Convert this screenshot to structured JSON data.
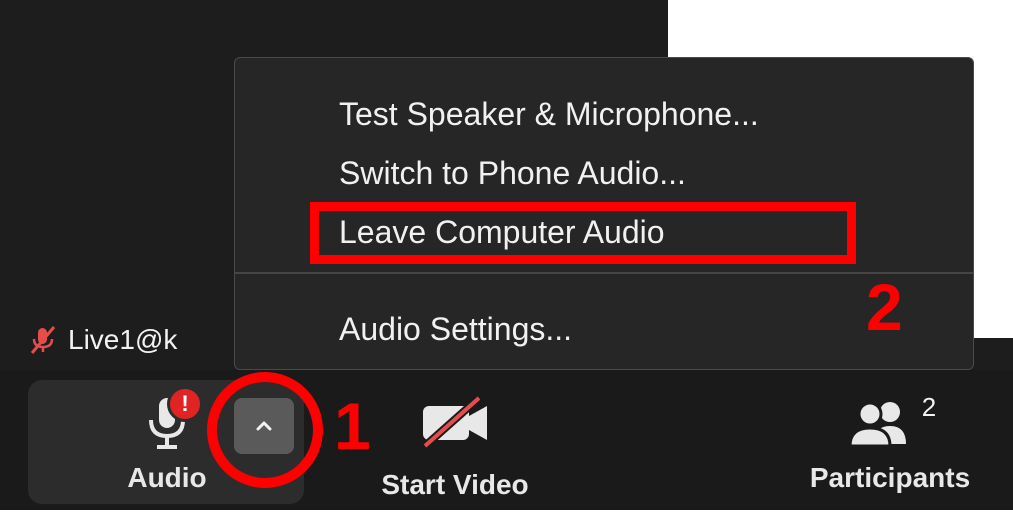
{
  "menu": {
    "items": [
      {
        "label": "Test Speaker & Microphone..."
      },
      {
        "label": "Switch to Phone Audio..."
      },
      {
        "label": "Leave Computer Audio"
      },
      {
        "label": "Audio Settings..."
      }
    ]
  },
  "participant_label": {
    "name": "Live1@k"
  },
  "toolbar": {
    "audio_label": "Audio",
    "audio_alert": "!",
    "video_label": "Start Video",
    "participants_label": "Participants",
    "participants_count": "2"
  },
  "annotations": {
    "step1": "1",
    "step2": "2"
  },
  "colors": {
    "annotation": "#ff0000",
    "menu_bg": "#262626",
    "toolbar_bg": "#1a1a1a",
    "alert_badge": "#e02424"
  },
  "icons": {
    "muted_mic": "muted-mic-icon",
    "microphone": "microphone-icon",
    "caret": "chevron-up-icon",
    "video_off": "video-off-icon",
    "participants": "participants-icon"
  }
}
